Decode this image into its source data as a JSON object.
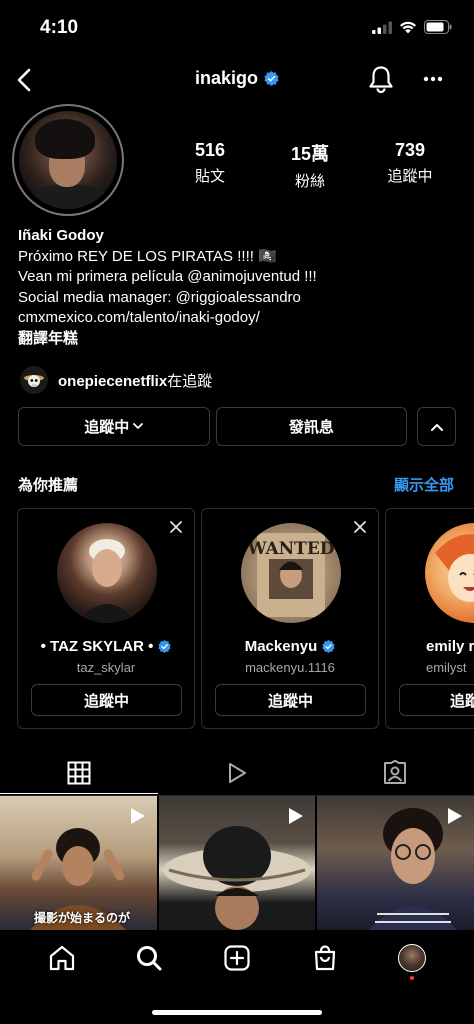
{
  "status_bar": {
    "time": "4:10"
  },
  "header": {
    "username": "inakigo"
  },
  "profile": {
    "stats": [
      {
        "value": "516",
        "label": "貼文"
      },
      {
        "value": "15萬",
        "label": "粉絲"
      },
      {
        "value": "739",
        "label": "追蹤中"
      }
    ],
    "display_name": "Iñaki Godoy",
    "bio_lines": [
      "Próximo REY DE LOS PIRATAS !!!! 🏴‍☠️",
      "Vean mi primera película @animojuventud !!!",
      "Social media manager: @riggioalessandro",
      "cmxmexico.com/talento/inaki-godoy/"
    ],
    "translate": "翻譯年糕",
    "mutual": {
      "name": "onepiecenetflix",
      "suffix": "在追蹤"
    }
  },
  "actions": {
    "following": "追蹤中",
    "message": "發訊息"
  },
  "suggestions": {
    "title": "為你推薦",
    "see_all": "顯示全部",
    "cards": [
      {
        "name": "• TAZ SKYLAR •",
        "handle": "taz_skylar",
        "button": "追蹤中"
      },
      {
        "name": "Mackenyu",
        "handle": "mackenyu.1116",
        "button": "追蹤中",
        "poster_text": "WANTED"
      },
      {
        "name": "emily r",
        "handle": "emilyst",
        "button": "追蹤"
      }
    ]
  },
  "posts": [
    {
      "caption": "撮影が始まるのが"
    },
    {
      "caption": ""
    },
    {
      "caption": ""
    }
  ],
  "colors": {
    "accent": "#3897f0",
    "verified": "#3897f0",
    "notification_dot": "#ff3040"
  }
}
